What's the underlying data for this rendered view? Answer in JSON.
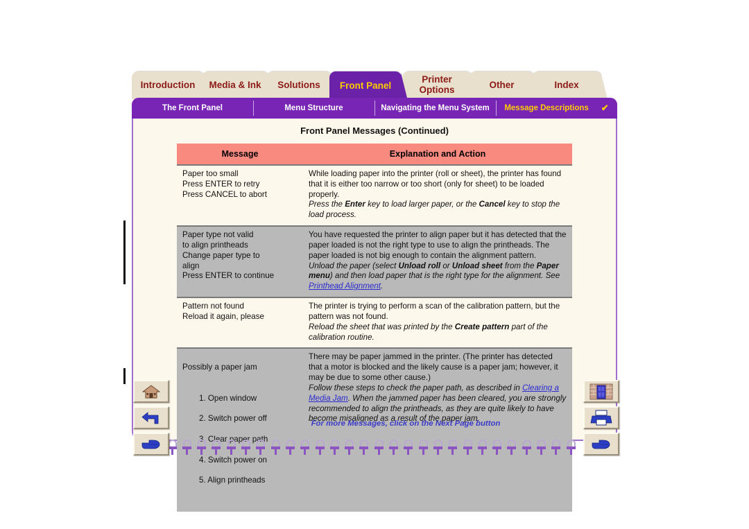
{
  "colors": {
    "purple": "#7824b5",
    "tab_active_bg": "#6b21a8",
    "tab_active_text": "#ffcc00",
    "tab_inactive_bg": "#e8e0cd",
    "tab_inactive_text": "#8c1a16",
    "page_bg": "#fdf8ec",
    "table_header_bg": "#f98a80",
    "row_shade_bg": "#b9b9b9",
    "link": "#2b2bd0",
    "footnote": "#3b3bc8"
  },
  "tabs": [
    {
      "label": "Introduction",
      "active": false
    },
    {
      "label": "Media & Ink",
      "active": false
    },
    {
      "label": "Solutions",
      "active": false
    },
    {
      "label": "Front Panel",
      "active": true
    },
    {
      "label_line1": "Printer",
      "label_line2": "Options",
      "active": false
    },
    {
      "label": "Other",
      "active": false
    },
    {
      "label": "Index",
      "active": false
    }
  ],
  "subnav": {
    "items": [
      {
        "label": "The Front Panel",
        "current": false
      },
      {
        "label": "Menu Structure",
        "current": false
      },
      {
        "label": "Navigating the Menu System",
        "current": false
      },
      {
        "label": "Message Descriptions",
        "current": true
      }
    ],
    "check_glyph": "✔"
  },
  "page": {
    "title": "Front Panel Messages (Continued)",
    "footnote": "For more Messages, click on the Next Page button"
  },
  "table": {
    "headers": {
      "message": "Message",
      "explanation": "Explanation and Action"
    },
    "rows": [
      {
        "shaded": false,
        "message": "Paper too small\nPress ENTER to retry\nPress CANCEL to abort",
        "explanation_plain": "While loading paper into the printer (roll or sheet), the printer has found that it is either too narrow or too short (only for sheet) to be loaded properly.",
        "explanation_italic_1": "Press the ",
        "explanation_bold_1": "Enter",
        "explanation_italic_2": " key to load larger paper, or the ",
        "explanation_bold_2": "Cancel",
        "explanation_italic_3": " key to stop the load process."
      },
      {
        "shaded": true,
        "message": "Paper type not valid\nto align printheads\nChange paper type to\nalign\nPress ENTER to continue",
        "explanation_plain": "You have requested the printer to align paper but it has detected that the paper loaded is not the right type to use to align the printheads. The paper loaded is not big enough to contain the alignment pattern.",
        "explanation_italic_1": "Unload the paper (select ",
        "explanation_bold_1": "Unload roll",
        "explanation_italic_2": " or ",
        "explanation_bold_2": "Unload sheet",
        "explanation_italic_3": " from the ",
        "explanation_bold_3": "Paper menu",
        "explanation_italic_4": ") and then load paper that is the right type for the alignment. See ",
        "explanation_link": "Printhead Alignment",
        "explanation_italic_5": "."
      },
      {
        "shaded": false,
        "message": "Pattern not found\nReload it again, please",
        "explanation_plain": "The printer is trying to perform a scan of the calibration pattern, but the pattern was not found.",
        "explanation_italic_1": "Reload the sheet that was printed by the ",
        "explanation_bold_1": "Create pattern",
        "explanation_italic_2": " part of the calibration routine."
      },
      {
        "shaded": true,
        "message": "Possibly a paper jam",
        "message_steps": [
          "Open window",
          "Switch power off",
          "Clear paper path",
          "Switch power on",
          "Align printheads"
        ],
        "explanation_plain": "There may be paper jammed in the printer. (The printer has detected that a motor is blocked and the likely cause is a paper jam; however, it may be due to some other cause.)",
        "explanation_italic_1": "Follow these steps to check the paper path, as described in ",
        "explanation_link": "Clearing a Media Jam",
        "explanation_italic_2": ". When the jammed paper has been cleared, you are strongly recommended to align the printheads, as they are quite likely to have become misaligned as a result of the paper jam."
      }
    ]
  },
  "nav_buttons": {
    "left": [
      {
        "icon": "home-icon"
      },
      {
        "icon": "back-arrow-icon"
      },
      {
        "icon": "forward-hand-icon"
      }
    ],
    "right": [
      {
        "icon": "exit-door-icon"
      },
      {
        "icon": "printer-icon"
      },
      {
        "icon": "forward-hand-icon"
      }
    ]
  }
}
